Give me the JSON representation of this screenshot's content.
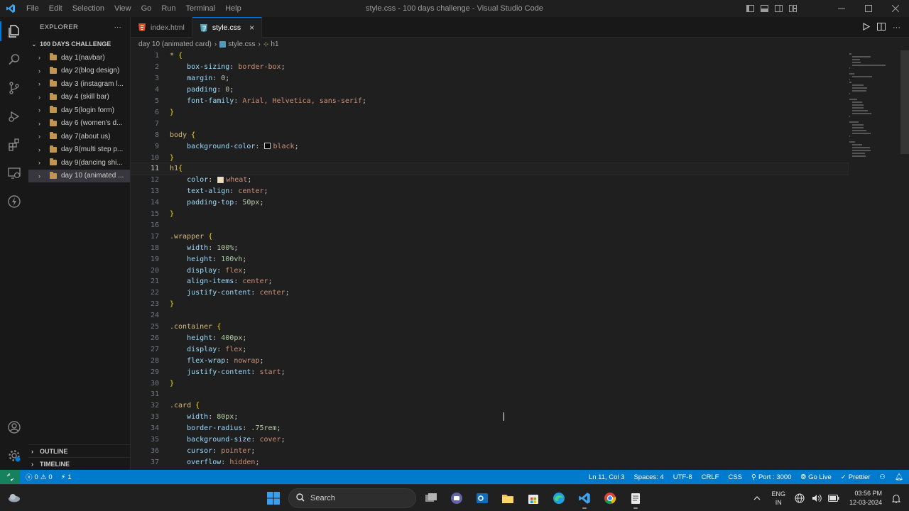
{
  "window": {
    "title": "style.css - 100 days challenge - Visual Studio Code",
    "menu": [
      "File",
      "Edit",
      "Selection",
      "View",
      "Go",
      "Run",
      "Terminal",
      "Help"
    ]
  },
  "sidebar": {
    "header": "EXPLORER",
    "more": "···",
    "folder": "100 DAYS CHALLENGE",
    "items": [
      {
        "label": "day 1(navbar)"
      },
      {
        "label": "day 2(blog design)"
      },
      {
        "label": "day 3 (instagram l..."
      },
      {
        "label": "day 4 (skill bar)"
      },
      {
        "label": "day 5(login form)"
      },
      {
        "label": "day 6 (women's d..."
      },
      {
        "label": "day 7(about us)"
      },
      {
        "label": "day 8(multi step p..."
      },
      {
        "label": "day 9(dancing shi..."
      },
      {
        "label": "day 10 (animated ..."
      }
    ],
    "outline": "OUTLINE",
    "timeline": "TIMELINE"
  },
  "tabs": [
    {
      "label": "index.html",
      "icon": "html-file-icon",
      "active": false
    },
    {
      "label": "style.css",
      "icon": "css-file-icon",
      "active": true
    }
  ],
  "breadcrumb": {
    "folder": "day 10 (animated card)",
    "file": "style.css",
    "symbol": "h1"
  },
  "code": [
    [
      [
        "t-sel",
        "* "
      ],
      [
        "t-brace",
        "{"
      ]
    ],
    [
      [
        "",
        "    "
      ],
      [
        "t-prop",
        "box-sizing"
      ],
      [
        "t-punc",
        ": "
      ],
      [
        "t-val",
        "border-box"
      ],
      [
        "t-punc",
        ";"
      ]
    ],
    [
      [
        "",
        "    "
      ],
      [
        "t-prop",
        "margin"
      ],
      [
        "t-punc",
        ": "
      ],
      [
        "t-num",
        "0"
      ],
      [
        "t-punc",
        ";"
      ]
    ],
    [
      [
        "",
        "    "
      ],
      [
        "t-prop",
        "padding"
      ],
      [
        "t-punc",
        ": "
      ],
      [
        "t-num",
        "0"
      ],
      [
        "t-punc",
        ";"
      ]
    ],
    [
      [
        "",
        "    "
      ],
      [
        "t-prop",
        "font-family"
      ],
      [
        "t-punc",
        ": "
      ],
      [
        "t-val",
        "Arial, Helvetica, sans-serif"
      ],
      [
        "t-punc",
        ";"
      ]
    ],
    [
      [
        "t-brace",
        "}"
      ]
    ],
    [],
    [
      [
        "t-sel",
        "body "
      ],
      [
        "t-brace",
        "{"
      ]
    ],
    [
      [
        "",
        "    "
      ],
      [
        "t-prop",
        "background-color"
      ],
      [
        "t-punc",
        ": "
      ],
      [
        "swatch",
        "#000000"
      ],
      [
        "t-val",
        "black"
      ],
      [
        "t-punc",
        ";"
      ]
    ],
    [
      [
        "t-brace",
        "}"
      ]
    ],
    [
      [
        "t-sel",
        "h1"
      ],
      [
        "t-brace",
        "{"
      ]
    ],
    [
      [
        "",
        "    "
      ],
      [
        "t-prop",
        "color"
      ],
      [
        "t-punc",
        ": "
      ],
      [
        "swatch",
        "#f5deb3"
      ],
      [
        "t-val",
        "wheat"
      ],
      [
        "t-punc",
        ";"
      ]
    ],
    [
      [
        "",
        "    "
      ],
      [
        "t-prop",
        "text-align"
      ],
      [
        "t-punc",
        ": "
      ],
      [
        "t-val",
        "center"
      ],
      [
        "t-punc",
        ";"
      ]
    ],
    [
      [
        "",
        "    "
      ],
      [
        "t-prop",
        "padding-top"
      ],
      [
        "t-punc",
        ": "
      ],
      [
        "t-num",
        "50px"
      ],
      [
        "t-punc",
        ";"
      ]
    ],
    [
      [
        "t-brace",
        "}"
      ]
    ],
    [],
    [
      [
        "t-sel",
        ".wrapper "
      ],
      [
        "t-brace",
        "{"
      ]
    ],
    [
      [
        "",
        "    "
      ],
      [
        "t-prop",
        "width"
      ],
      [
        "t-punc",
        ": "
      ],
      [
        "t-num",
        "100%"
      ],
      [
        "t-punc",
        ";"
      ]
    ],
    [
      [
        "",
        "    "
      ],
      [
        "t-prop",
        "height"
      ],
      [
        "t-punc",
        ": "
      ],
      [
        "t-num",
        "100vh"
      ],
      [
        "t-punc",
        ";"
      ]
    ],
    [
      [
        "",
        "    "
      ],
      [
        "t-prop",
        "display"
      ],
      [
        "t-punc",
        ": "
      ],
      [
        "t-val",
        "flex"
      ],
      [
        "t-punc",
        ";"
      ]
    ],
    [
      [
        "",
        "    "
      ],
      [
        "t-prop",
        "align-items"
      ],
      [
        "t-punc",
        ": "
      ],
      [
        "t-val",
        "center"
      ],
      [
        "t-punc",
        ";"
      ]
    ],
    [
      [
        "",
        "    "
      ],
      [
        "t-prop",
        "justify-content"
      ],
      [
        "t-punc",
        ": "
      ],
      [
        "t-val",
        "center"
      ],
      [
        "t-punc",
        ";"
      ]
    ],
    [
      [
        "t-brace",
        "}"
      ]
    ],
    [],
    [
      [
        "t-sel",
        ".container "
      ],
      [
        "t-brace",
        "{"
      ]
    ],
    [
      [
        "",
        "    "
      ],
      [
        "t-prop",
        "height"
      ],
      [
        "t-punc",
        ": "
      ],
      [
        "t-num",
        "400px"
      ],
      [
        "t-punc",
        ";"
      ]
    ],
    [
      [
        "",
        "    "
      ],
      [
        "t-prop",
        "display"
      ],
      [
        "t-punc",
        ": "
      ],
      [
        "t-val",
        "flex"
      ],
      [
        "t-punc",
        ";"
      ]
    ],
    [
      [
        "",
        "    "
      ],
      [
        "t-prop",
        "flex-wrap"
      ],
      [
        "t-punc",
        ": "
      ],
      [
        "t-val",
        "nowrap"
      ],
      [
        "t-punc",
        ";"
      ]
    ],
    [
      [
        "",
        "    "
      ],
      [
        "t-prop",
        "justify-content"
      ],
      [
        "t-punc",
        ": "
      ],
      [
        "t-val",
        "start"
      ],
      [
        "t-punc",
        ";"
      ]
    ],
    [
      [
        "t-brace",
        "}"
      ]
    ],
    [],
    [
      [
        "t-sel",
        ".card "
      ],
      [
        "t-brace",
        "{"
      ]
    ],
    [
      [
        "",
        "    "
      ],
      [
        "t-prop",
        "width"
      ],
      [
        "t-punc",
        ": "
      ],
      [
        "t-num",
        "80px"
      ],
      [
        "t-punc",
        ";"
      ]
    ],
    [
      [
        "",
        "    "
      ],
      [
        "t-prop",
        "border-radius"
      ],
      [
        "t-punc",
        ": "
      ],
      [
        "t-num",
        ".75rem"
      ],
      [
        "t-punc",
        ";"
      ]
    ],
    [
      [
        "",
        "    "
      ],
      [
        "t-prop",
        "background-size"
      ],
      [
        "t-punc",
        ": "
      ],
      [
        "t-val",
        "cover"
      ],
      [
        "t-punc",
        ";"
      ]
    ],
    [
      [
        "",
        "    "
      ],
      [
        "t-prop",
        "cursor"
      ],
      [
        "t-punc",
        ": "
      ],
      [
        "t-val",
        "pointer"
      ],
      [
        "t-punc",
        ";"
      ]
    ],
    [
      [
        "",
        "    "
      ],
      [
        "t-prop",
        "overflow"
      ],
      [
        "t-punc",
        ": "
      ],
      [
        "t-val",
        "hidden"
      ],
      [
        "t-punc",
        ";"
      ]
    ]
  ],
  "current_line": 11,
  "statusbar": {
    "errors": "0",
    "warnings": "0",
    "ports": "1",
    "position": "Ln 11, Col 3",
    "spaces": "Spaces: 4",
    "encoding": "UTF-8",
    "eol": "CRLF",
    "language": "CSS",
    "port": "Port : 3000",
    "golive": "Go Live",
    "prettier": "Prettier"
  },
  "taskbar": {
    "search": "Search",
    "lang1": "ENG",
    "lang2": "IN",
    "time": "03:56 PM",
    "date": "12-03-2024"
  },
  "colors": {
    "accent": "#0078d4",
    "statusbar": "#007acc",
    "remote": "#16825d"
  }
}
